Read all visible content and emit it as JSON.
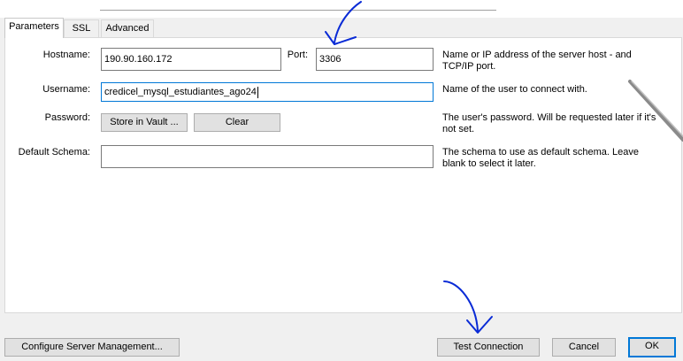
{
  "tabs": [
    {
      "label": "Parameters",
      "active": true
    },
    {
      "label": "SSL",
      "active": false
    },
    {
      "label": "Advanced",
      "active": false
    }
  ],
  "fields": {
    "hostname": {
      "label": "Hostname:",
      "value": "190.90.160.172"
    },
    "port": {
      "label": "Port:",
      "value": "3306"
    },
    "username": {
      "label": "Username:",
      "value": "credicel_mysql_estudiantes_ago24"
    },
    "password": {
      "label": "Password:",
      "store_label": "Store in Vault ...",
      "clear_label": "Clear"
    },
    "default_schema": {
      "label": "Default Schema:",
      "value": ""
    }
  },
  "descriptions": {
    "hostname": "Name or IP address of the server host - and TCP/IP port.",
    "username": "Name of the user to connect with.",
    "password": "The user's password. Will be requested later if it's not set.",
    "default_schema": "The schema to use as default schema. Leave blank to select it later."
  },
  "footer": {
    "configure_label": "Configure Server Management...",
    "test_label": "Test Connection",
    "cancel_label": "Cancel",
    "ok_label": "OK"
  },
  "colors": {
    "focus_border": "#0078d7",
    "annotation_ink": "#0a2bd6",
    "dialog_bg": "#f0f0f0"
  }
}
